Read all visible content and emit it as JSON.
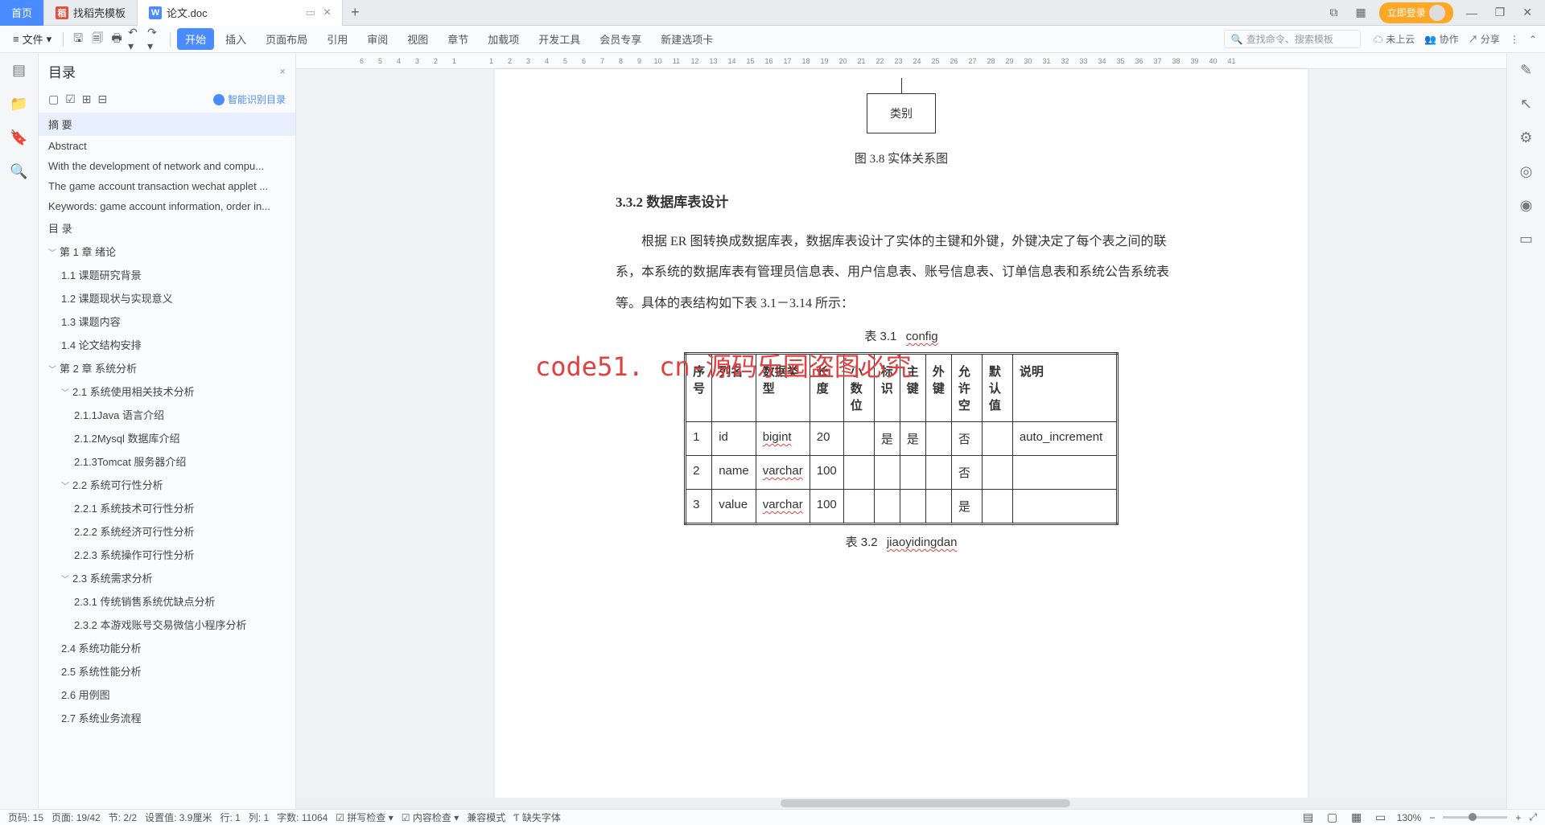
{
  "tabs": {
    "home": "首页",
    "template": "找稻壳模板",
    "doc": "论文.doc",
    "new": "+",
    "login": "立即登录"
  },
  "toolbar": {
    "file": "文件",
    "start": "开始",
    "insert": "插入",
    "layout": "页面布局",
    "ref": "引用",
    "review": "审阅",
    "view": "视图",
    "chapter": "章节",
    "addon": "加载项",
    "dev": "开发工具",
    "vip": "会员专享",
    "newtab": "新建选项卡",
    "search_ph": "查找命令、搜索模板",
    "cloud": "未上云",
    "collab": "协作",
    "share": "分享"
  },
  "outline": {
    "title": "目录",
    "ai": "智能识别目录"
  },
  "toc": [
    {
      "lvl": 1,
      "t": "摘  要",
      "sel": true
    },
    {
      "lvl": 1,
      "t": "Abstract"
    },
    {
      "lvl": 1,
      "t": "With the development of network and compu..."
    },
    {
      "lvl": 1,
      "t": "The game account transaction wechat applet ..."
    },
    {
      "lvl": 1,
      "t": "Keywords: game account information, order in..."
    },
    {
      "lvl": 1,
      "t": "目  录"
    },
    {
      "lvl": 1,
      "t": "第 1 章    绪论",
      "c": true
    },
    {
      "lvl": 2,
      "t": "1.1 课题研究背景"
    },
    {
      "lvl": 2,
      "t": "1.2 课题现状与实现意义"
    },
    {
      "lvl": 2,
      "t": "1.3 课题内容"
    },
    {
      "lvl": 2,
      "t": "1.4 论文结构安排"
    },
    {
      "lvl": 1,
      "t": "第 2 章    系统分析",
      "c": true
    },
    {
      "lvl": 2,
      "t": "2.1 系统使用相关技术分析",
      "c": true
    },
    {
      "lvl": 3,
      "t": "2.1.1Java 语言介绍"
    },
    {
      "lvl": 3,
      "t": "2.1.2Mysql 数据库介绍"
    },
    {
      "lvl": 3,
      "t": "2.1.3Tomcat 服务器介绍"
    },
    {
      "lvl": 2,
      "t": "2.2 系统可行性分析",
      "c": true
    },
    {
      "lvl": 3,
      "t": "2.2.1 系统技术可行性分析"
    },
    {
      "lvl": 3,
      "t": "2.2.2 系统经济可行性分析"
    },
    {
      "lvl": 3,
      "t": "2.2.3 系统操作可行性分析"
    },
    {
      "lvl": 2,
      "t": "2.3 系统需求分析",
      "c": true
    },
    {
      "lvl": 3,
      "t": "2.3.1 传统销售系统优缺点分析"
    },
    {
      "lvl": 3,
      "t": "2.3.2 本游戏账号交易微信小程序分析"
    },
    {
      "lvl": 2,
      "t": "2.4 系统功能分析"
    },
    {
      "lvl": 2,
      "t": "2.5 系统性能分析"
    },
    {
      "lvl": 2,
      "t": "2.6 用例图"
    },
    {
      "lvl": 2,
      "t": "2.7 系统业务流程"
    }
  ],
  "ruler": [
    "6",
    "5",
    "4",
    "3",
    "2",
    "1",
    "",
    "1",
    "2",
    "3",
    "4",
    "5",
    "6",
    "7",
    "8",
    "9",
    "10",
    "11",
    "12",
    "13",
    "14",
    "15",
    "16",
    "17",
    "18",
    "19",
    "20",
    "21",
    "22",
    "23",
    "24",
    "25",
    "26",
    "27",
    "28",
    "29",
    "30",
    "31",
    "32",
    "33",
    "34",
    "35",
    "36",
    "37",
    "38",
    "39",
    "40",
    "41"
  ],
  "doc": {
    "entity": "类别",
    "fig_cap": "图 3.8 实体关系图",
    "h4": "3.3.2 数据库表设计",
    "para": "根据 ER 图转换成数据库表，数据库表设计了实体的主键和外键，外键决定了每个表之间的联系，本系统的数据库表有管理员信息表、用户信息表、账号信息表、订单信息表和系统公告系统表等。具体的表结构如下表 3.1－3.14 所示：",
    "watermark": "code51. cn-源码乐园盗图必究",
    "tbl1_cap_a": "表 3.1",
    "tbl1_cap_b": "config",
    "tbl2_cap_a": "表 3.2",
    "tbl2_cap_b": "jiaoyidingdan",
    "headers": [
      "序号",
      "列名",
      "数据类型",
      "长度",
      "小数位",
      "标识",
      "主键",
      "外键",
      "允许空",
      "默认值",
      "说明"
    ],
    "rows": [
      [
        "1",
        "id",
        "bigint",
        "20",
        "",
        "是",
        "是",
        "",
        "否",
        "",
        "auto_increment"
      ],
      [
        "2",
        "name",
        "varchar",
        "100",
        "",
        "",
        "",
        "",
        "否",
        "",
        ""
      ],
      [
        "3",
        "value",
        "varchar",
        "100",
        "",
        "",
        "",
        "",
        "是",
        "",
        ""
      ]
    ]
  },
  "status": {
    "page_no": "页码: 15",
    "pages": "页面: 19/42",
    "section": "节: 2/2",
    "indent": "设置值: 3.9厘米",
    "line": "行: 1",
    "col": "列: 1",
    "words": "字数: 11064",
    "spell": "拼写检查",
    "content": "内容检查",
    "compat": "兼容模式",
    "font": "缺失字体",
    "zoom": "130%"
  }
}
